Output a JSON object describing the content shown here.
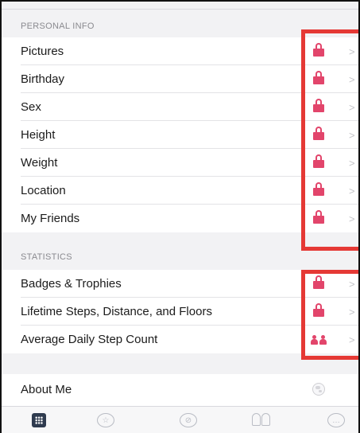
{
  "personal_info": {
    "header": "PERSONAL INFO",
    "rows": [
      {
        "label": "Pictures",
        "privacy_icon": "lock-icon"
      },
      {
        "label": "Birthday",
        "privacy_icon": "lock-icon"
      },
      {
        "label": "Sex",
        "privacy_icon": "lock-icon"
      },
      {
        "label": "Height",
        "privacy_icon": "lock-icon"
      },
      {
        "label": "Weight",
        "privacy_icon": "lock-icon"
      },
      {
        "label": "Location",
        "privacy_icon": "lock-icon"
      },
      {
        "label": "My Friends",
        "privacy_icon": "lock-icon"
      }
    ]
  },
  "statistics": {
    "header": "STATISTICS",
    "rows": [
      {
        "label": "Badges & Trophies",
        "privacy_icon": "lock-icon"
      },
      {
        "label": "Lifetime Steps, Distance, and Floors",
        "privacy_icon": "lock-icon"
      },
      {
        "label": "Average Daily Step Count",
        "privacy_icon": "friends-icon"
      }
    ]
  },
  "about": {
    "rows": [
      {
        "label": "About Me",
        "privacy_icon": "globe-icon"
      }
    ]
  },
  "chevron": ">",
  "tabbar": {
    "items": [
      {
        "icon": "dashboard-icon"
      },
      {
        "icon": "challenges-star-icon"
      },
      {
        "icon": "discover-compass-icon"
      },
      {
        "icon": "friends-icon"
      },
      {
        "icon": "messages-chat-icon"
      }
    ]
  },
  "colors": {
    "accent_pink": "#e2456b",
    "highlight_red": "#e53935",
    "background": "#f2f2f4",
    "chevron": "#c4c4c8"
  }
}
